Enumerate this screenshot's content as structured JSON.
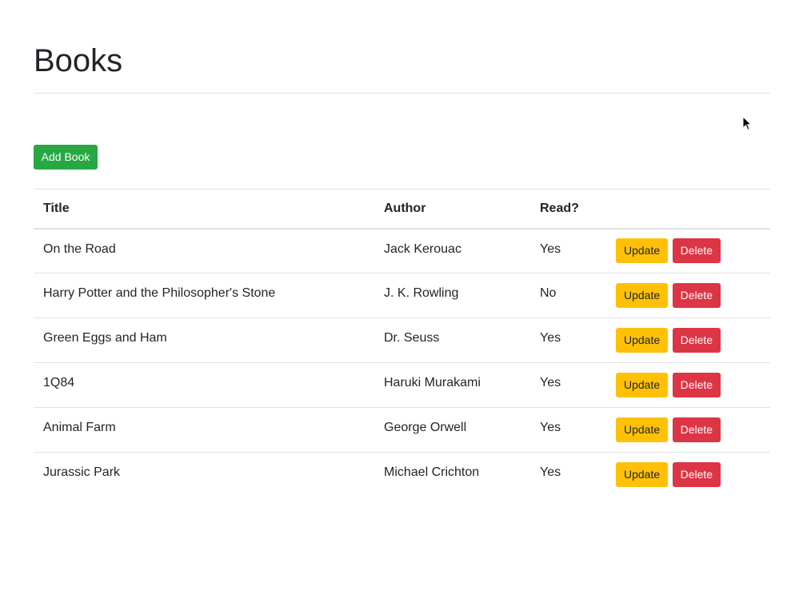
{
  "page": {
    "title": "Books"
  },
  "toolbar": {
    "add_label": "Add Book"
  },
  "table": {
    "columns": [
      "Title",
      "Author",
      "Read?",
      ""
    ],
    "rows": [
      {
        "title": "On the Road",
        "author": "Jack Kerouac",
        "read": "Yes"
      },
      {
        "title": "Harry Potter and the Philosopher's Stone",
        "author": "J. K. Rowling",
        "read": "No"
      },
      {
        "title": "Green Eggs and Ham",
        "author": "Dr. Seuss",
        "read": "Yes"
      },
      {
        "title": "1Q84",
        "author": "Haruki Murakami",
        "read": "Yes"
      },
      {
        "title": "Animal Farm",
        "author": "George Orwell",
        "read": "Yes"
      },
      {
        "title": "Jurassic Park",
        "author": "Michael Crichton",
        "read": "Yes"
      }
    ],
    "actions": {
      "update_label": "Update",
      "delete_label": "Delete"
    }
  },
  "colors": {
    "success": "#28a745",
    "warning": "#ffc107",
    "danger": "#dc3545",
    "border": "#dee2e6",
    "text": "#212529"
  },
  "icons": {
    "cursor": "mouse-pointer-icon"
  }
}
